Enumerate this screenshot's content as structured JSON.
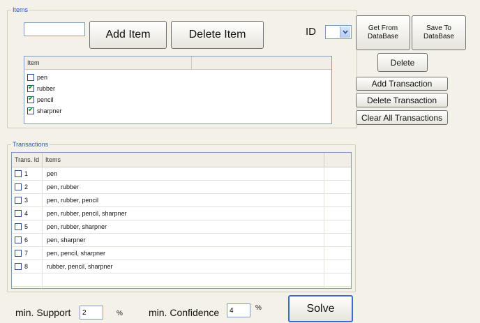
{
  "items_group": {
    "title": "Items",
    "new_item_value": "",
    "add_item_label": "Add Item",
    "delete_item_label": "Delete Item",
    "id_label": "ID",
    "id_value": "",
    "get_from_db_label": "Get From DataBase",
    "save_to_db_label": "Save To DataBase",
    "delete_label": "Delete",
    "add_transaction_label": "Add Transaction",
    "delete_transaction_label": "Delete Transaction",
    "clear_transactions_label": "Clear All Transactions",
    "list_header": "Item",
    "items": [
      {
        "label": "pen",
        "checked": false
      },
      {
        "label": "rubber",
        "checked": true
      },
      {
        "label": "pencil",
        "checked": true
      },
      {
        "label": "sharpner",
        "checked": true
      }
    ]
  },
  "transactions_group": {
    "title": "Transactions",
    "col_id": "Trans. Id",
    "col_items": "Items",
    "rows": [
      {
        "id": "1",
        "items": "pen"
      },
      {
        "id": "2",
        "items": "pen, rubber"
      },
      {
        "id": "3",
        "items": "pen, rubber, pencil"
      },
      {
        "id": "4",
        "items": "pen, rubber, pencil, sharpner"
      },
      {
        "id": "5",
        "items": "pen, rubber, sharpner"
      },
      {
        "id": "6",
        "items": "pen, sharpner"
      },
      {
        "id": "7",
        "items": "pen, pencil, sharpner"
      },
      {
        "id": "8",
        "items": "rubber, pencil, sharpner"
      }
    ]
  },
  "footer": {
    "min_support_label": "min. Support",
    "min_support_value": "2",
    "min_support_unit": "%",
    "min_confidence_label": "min. Confidence",
    "min_confidence_value": "4",
    "min_confidence_unit": "%",
    "solve_label": "Solve"
  },
  "colors": {
    "background": "#f4f2e8",
    "group_title": "#2255bb",
    "field_border": "#7f9db9",
    "checkbox_check": "#1a8a1a"
  },
  "icons": {
    "dropdown": "chevron-down-icon",
    "check": "check-icon"
  }
}
